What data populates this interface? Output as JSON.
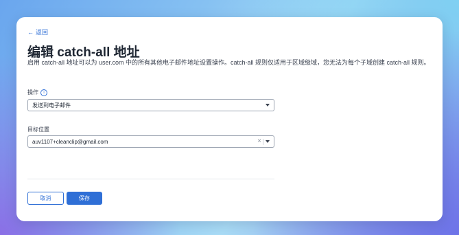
{
  "back": {
    "arrow": "←",
    "label": "返回"
  },
  "title": "编辑 catch-all 地址",
  "description": "启用 catch-all 地址可以为 user.com 中的所有其他电子邮件地址设置操作。catch-all 规则仅适用于区域级域，您无法为每个子域创建 catch-all 规则。",
  "action_field": {
    "label": "操作",
    "info_icon": "i",
    "value": "发送到电子邮件"
  },
  "destination_field": {
    "label": "目标位置",
    "value": "auv1107+cleanclip@gmail.com",
    "clear": "×"
  },
  "buttons": {
    "cancel": "取消",
    "save": "保存"
  },
  "colors": {
    "accent": "#2f6fd6",
    "title": "#1f2733"
  }
}
